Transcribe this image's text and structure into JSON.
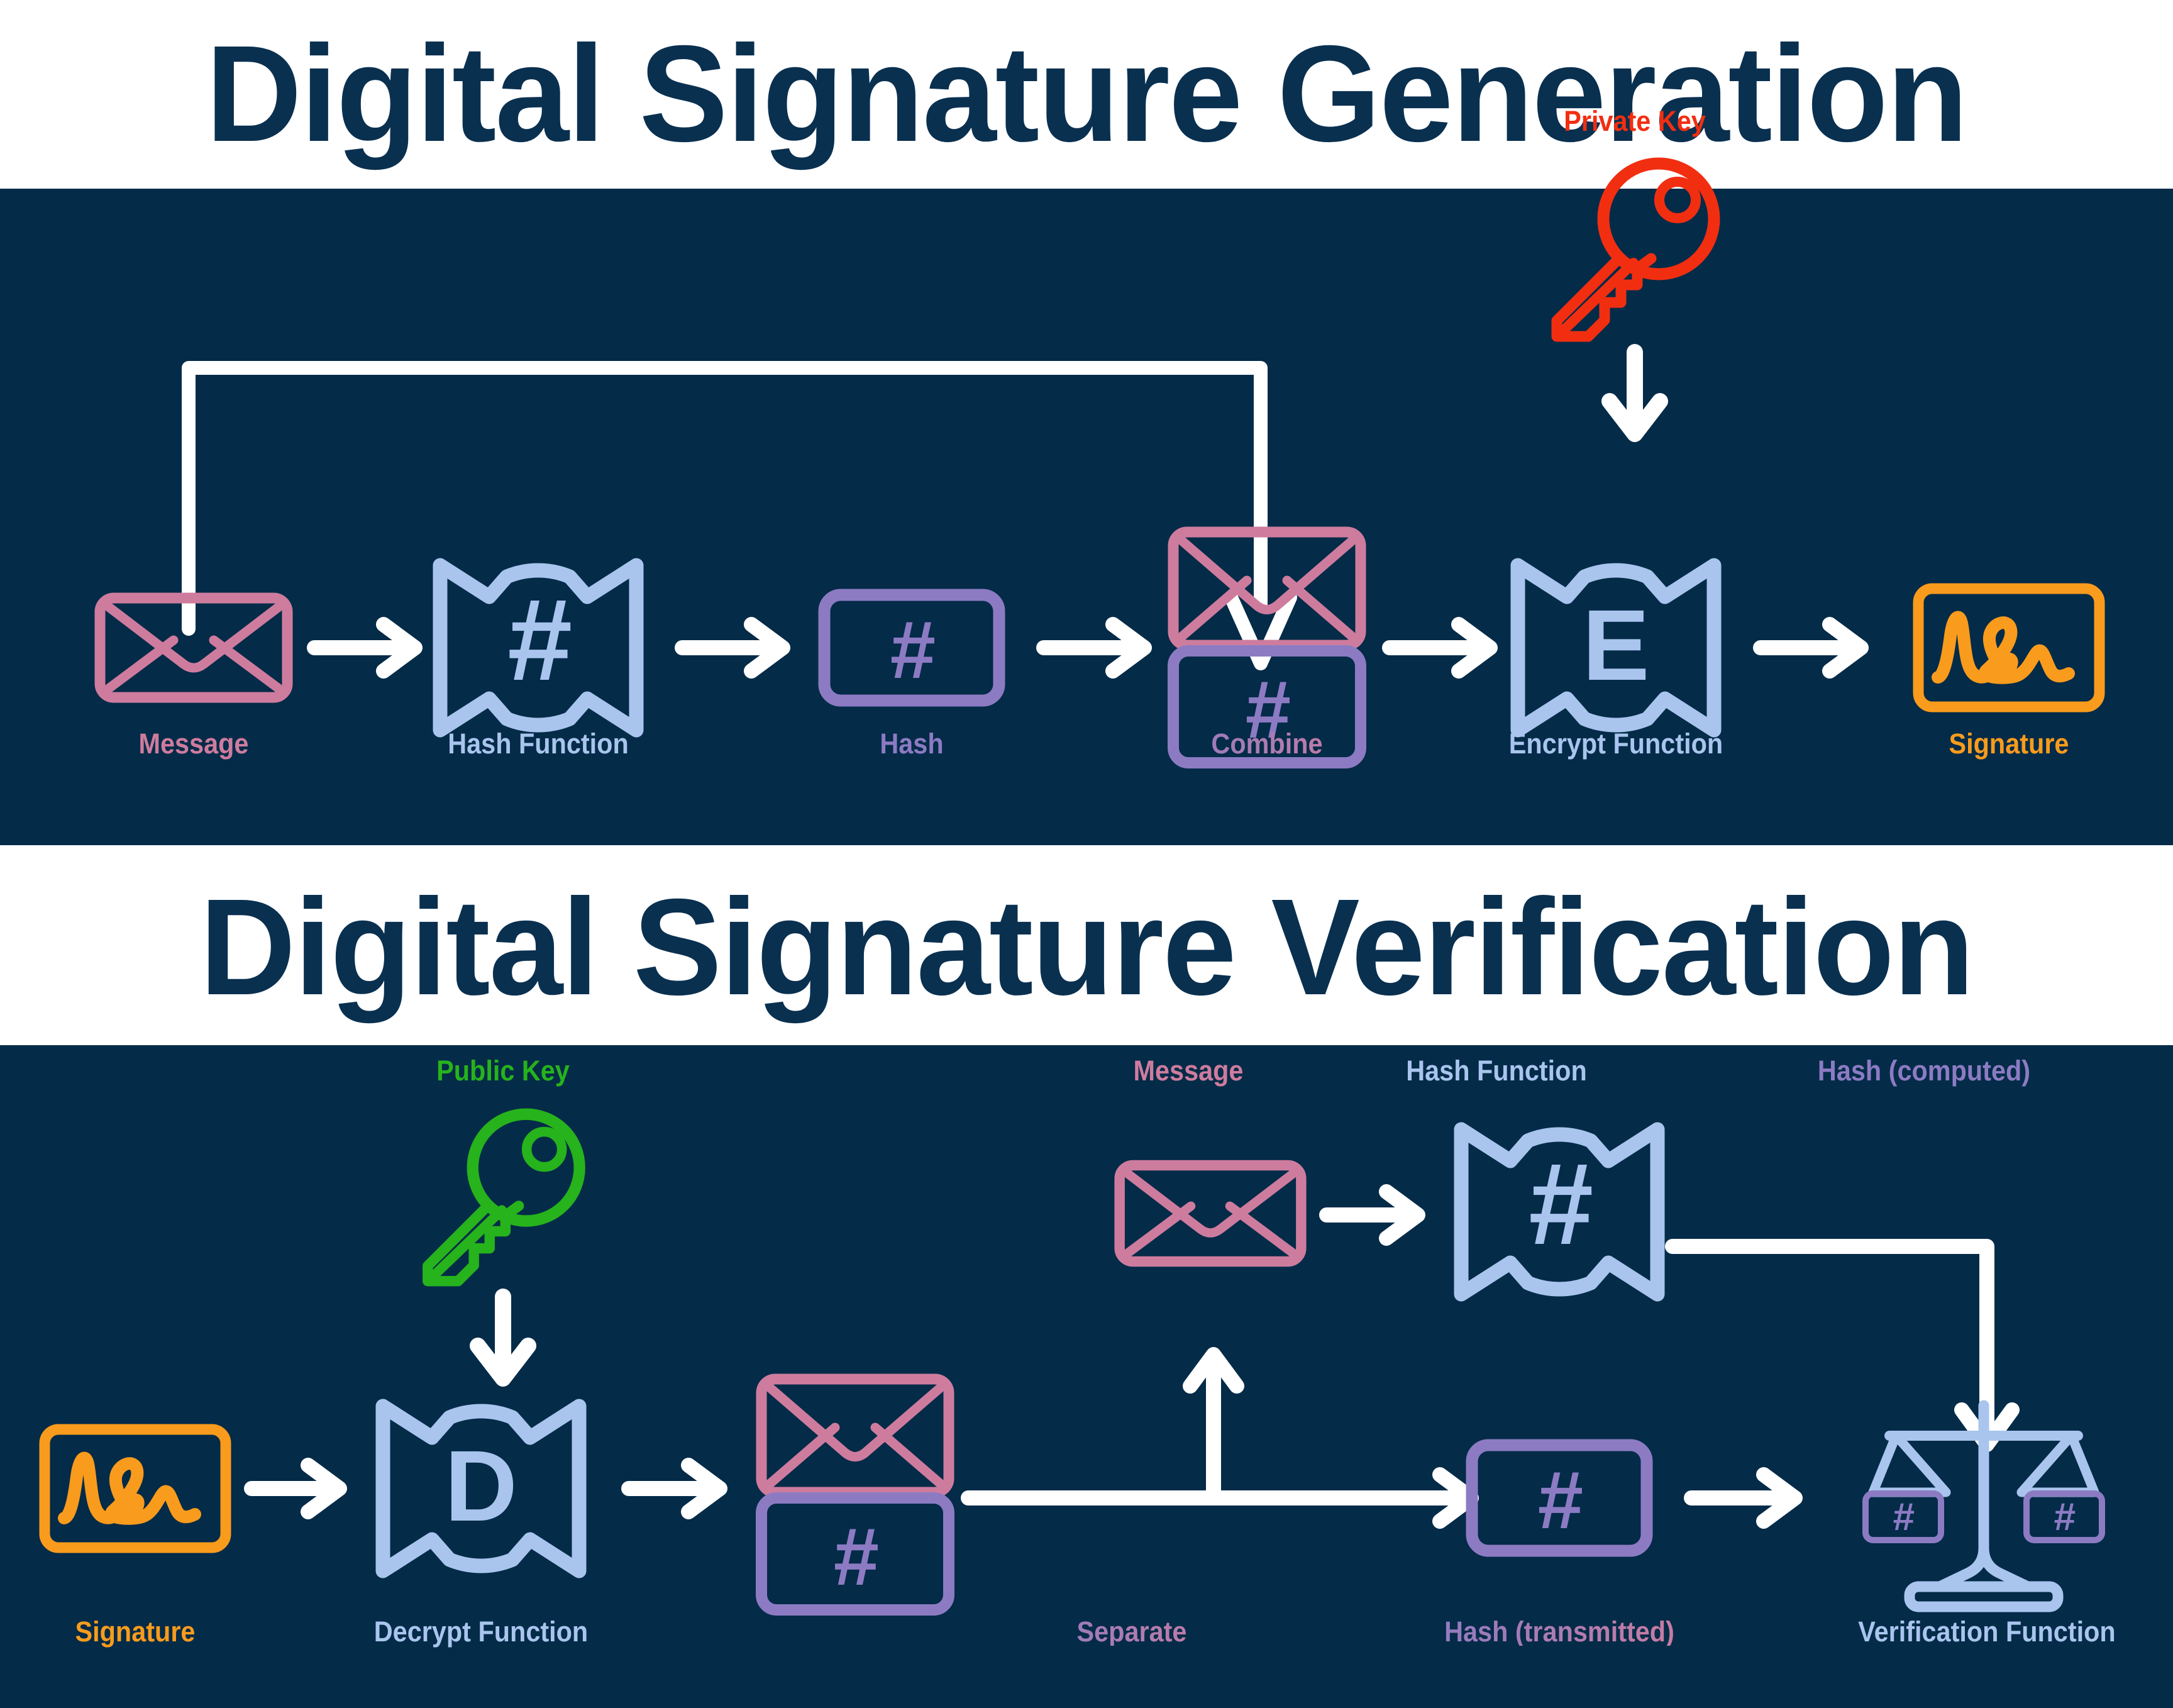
{
  "sections": [
    {
      "id": "generation",
      "title": "Digital Signature Generation",
      "steps": [
        {
          "key": "message",
          "label": "Message",
          "icon": "envelope-icon",
          "color": "#CE7C9E"
        },
        {
          "key": "hashfn",
          "label": "Hash Function",
          "icon": "hash-function-icon",
          "color": "#A9C5EE"
        },
        {
          "key": "hash",
          "label": "Hash",
          "icon": "hash-box-icon",
          "color": "#8C7BC3"
        },
        {
          "key": "combine",
          "label": "Combine",
          "icon": "combine-icon",
          "color": "#A98BBE"
        },
        {
          "key": "encryptfn",
          "label": "Encrypt Function",
          "icon": "encrypt-function-icon",
          "glyph": "E",
          "color": "#A9C5EE"
        },
        {
          "key": "signature",
          "label": "Signature",
          "icon": "signature-icon",
          "color": "#F99B1C"
        }
      ],
      "key": {
        "label": "Private Key",
        "icon": "key-icon",
        "color": "#F22E11"
      }
    },
    {
      "id": "verification",
      "title": "Digital Signature Verification",
      "key": {
        "label": "Public Key",
        "icon": "key-icon",
        "color": "#26B31C"
      },
      "steps": [
        {
          "key": "signature",
          "label": "Signature",
          "icon": "signature-icon",
          "color": "#F99B1C"
        },
        {
          "key": "decryptfn",
          "label": "Decrypt Function",
          "icon": "decrypt-function-icon",
          "glyph": "D",
          "color": "#A9C5EE"
        },
        {
          "key": "separate",
          "label": "Separate",
          "icon": "combine-icon",
          "color": "#A98BBE"
        },
        {
          "key": "message",
          "label": "Message",
          "icon": "envelope-icon",
          "color": "#CE7C9E"
        },
        {
          "key": "hashfn",
          "label": "Hash Function",
          "icon": "hash-function-icon",
          "color": "#A9C5EE"
        },
        {
          "key": "hashcomputed",
          "label": "Hash (computed)",
          "icon": "hash-label",
          "color": "#8C7BC3"
        },
        {
          "key": "hashtransmitted",
          "label": "Hash (transmitted)",
          "icon": "hash-box-icon",
          "color": "#8C7BC3"
        },
        {
          "key": "verifyfn",
          "label": "Verification Function",
          "icon": "balance-scale-icon",
          "color": "#A9C5EE"
        }
      ]
    }
  ],
  "glyphs": {
    "hash": "#",
    "encrypt": "E",
    "decrypt": "D"
  },
  "colors": {
    "background_dark": "#042B48",
    "background_light": "#ffffff",
    "title_text": "#0A3050",
    "arrow": "#FFFFFF",
    "pink": "#CE7C9E",
    "blue": "#A9C5EE",
    "purple": "#8C7BC3",
    "orange": "#F99B1C",
    "red": "#F22E11",
    "green": "#26B31C"
  }
}
